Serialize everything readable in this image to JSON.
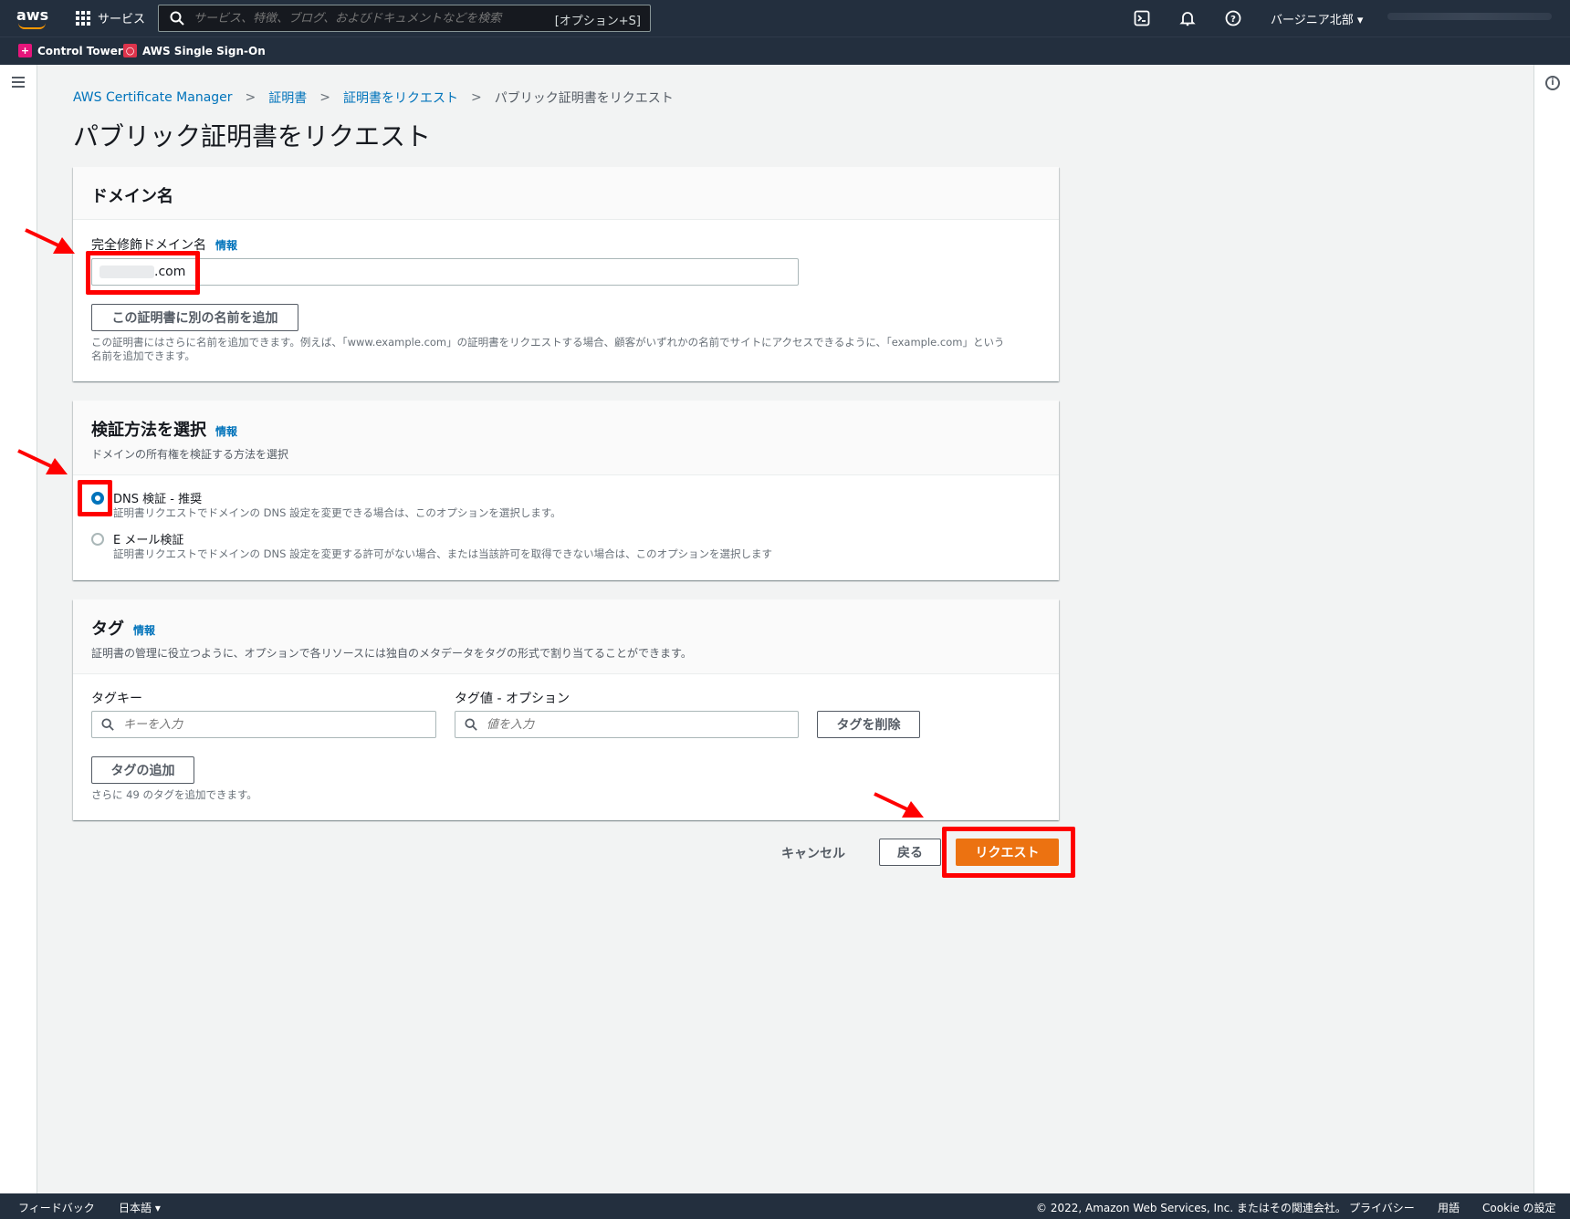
{
  "topnav": {
    "logo_text": "aws",
    "services_label": "サービス",
    "search_placeholder": "サービス、特徴、ブログ、およびドキュメントなどを検索",
    "search_shortcut": "[オプション+S]",
    "region_label": "バージニア北部 ▾",
    "favorites": [
      {
        "label": "Control Tower",
        "color": "#e7157b"
      },
      {
        "label": "AWS Single Sign-On",
        "color": "#dd344c"
      }
    ]
  },
  "breadcrumb": {
    "items": [
      "AWS Certificate Manager",
      "証明書",
      "証明書をリクエスト"
    ],
    "current": "パブリック証明書をリクエスト"
  },
  "page_title": "パブリック証明書をリクエスト",
  "domain_panel": {
    "title": "ドメイン名",
    "fqdn_label": "完全修飾ドメイン名",
    "info": "情報",
    "fqdn_value": ".com",
    "add_name_button": "この証明書に別の名前を追加",
    "hint_line1": "この証明書にはさらに名前を追加できます。例えば、「www.example.com」の証明書をリクエストする場合、顧客がいずれかの名前でサイトにアクセスできるように、「example.com」という",
    "hint_line2": "名前を追加できます。"
  },
  "validation_panel": {
    "title": "検証方法を選択",
    "info": "情報",
    "description": "ドメインの所有権を検証する方法を選択",
    "options": [
      {
        "label": "DNS 検証 - 推奨",
        "description": "証明書リクエストでドメインの DNS 設定を変更できる場合は、このオプションを選択します。",
        "checked": true
      },
      {
        "label": "E メール検証",
        "description": "証明書リクエストでドメインの DNS 設定を変更する許可がない場合、または当該許可を取得できない場合は、このオプションを選択します",
        "checked": false
      }
    ]
  },
  "tags_panel": {
    "title": "タグ",
    "info": "情報",
    "description": "証明書の管理に役立つように、オプションで各リソースには独自のメタデータをタグの形式で割り当てることができます。",
    "key_label": "タグキー",
    "key_placeholder": "キーを入力",
    "value_label": "タグ値 - オプション",
    "value_placeholder": "値を入力",
    "remove_button": "タグを削除",
    "add_button": "タグの追加",
    "remaining_hint": "さらに 49 のタグを追加できます。"
  },
  "actions": {
    "cancel": "キャンセル",
    "back": "戻る",
    "request": "リクエスト"
  },
  "footer": {
    "feedback": "フィードバック",
    "language": "日本語 ▾",
    "copyright": "© 2022, Amazon Web Services, Inc. またはその関連会社。",
    "privacy": "プライバシー",
    "terms": "用語",
    "cookies": "Cookie の設定"
  },
  "colors": {
    "nav_bg": "#232f3e",
    "link": "#0073bb",
    "primary_button": "#ec7211",
    "annotation": "#ff0000"
  }
}
